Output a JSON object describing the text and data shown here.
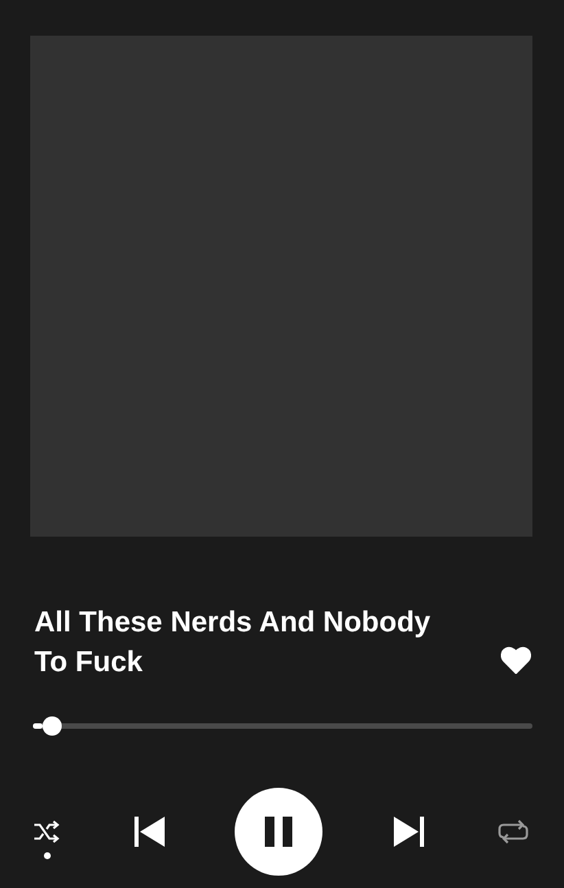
{
  "track": {
    "title": "All These Nerds And Nobody To Fuck",
    "liked": true
  },
  "progress": {
    "level": 0.02
  },
  "controls": {
    "shuffle": true,
    "playing": true,
    "repeat": false
  }
}
